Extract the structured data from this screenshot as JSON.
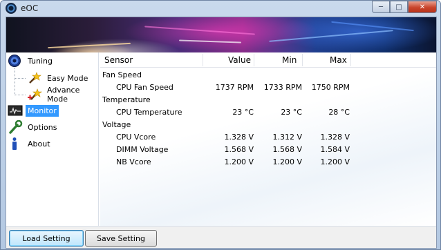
{
  "window": {
    "title": "eOC"
  },
  "sidebar": {
    "items": [
      {
        "label": "Tuning",
        "icon": "tuning-gauge-icon"
      },
      {
        "label": "Easy Mode",
        "icon": "magic-wand-icon"
      },
      {
        "label": "Advance Mode",
        "icon": "magic-wand-plus-icon"
      },
      {
        "label": "Monitor",
        "icon": "monitor-icon",
        "selected": true
      },
      {
        "label": "Options",
        "icon": "wrench-icon"
      },
      {
        "label": "About",
        "icon": "info-icon"
      }
    ]
  },
  "table": {
    "headers": {
      "sensor": "Sensor",
      "value": "Value",
      "min": "Min",
      "max": "Max"
    },
    "groups": [
      {
        "name": "Fan Speed",
        "rows": [
          {
            "sensor": "CPU Fan Speed",
            "value": "1737 RPM",
            "min": "1733 RPM",
            "max": "1750 RPM"
          }
        ]
      },
      {
        "name": "Temperature",
        "rows": [
          {
            "sensor": "CPU Temperature",
            "value": "23 °C",
            "min": "23 °C",
            "max": "28 °C"
          }
        ]
      },
      {
        "name": "Voltage",
        "rows": [
          {
            "sensor": "CPU Vcore",
            "value": "1.328 V",
            "min": "1.312 V",
            "max": "1.328 V"
          },
          {
            "sensor": "DIMM Voltage",
            "value": "1.568 V",
            "min": "1.568 V",
            "max": "1.584 V"
          },
          {
            "sensor": "NB Vcore",
            "value": "1.200 V",
            "min": "1.200 V",
            "max": "1.200 V"
          }
        ]
      }
    ]
  },
  "footer": {
    "load_label": "Load Setting",
    "save_label": "Save Setting"
  },
  "colors": {
    "selection": "#3399ff",
    "close_button": "#c9452c"
  }
}
